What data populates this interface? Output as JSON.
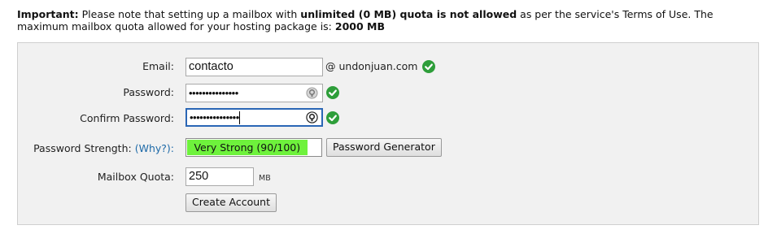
{
  "notice": {
    "important": "Important:",
    "t1": " Please note that setting up a mailbox with ",
    "t2": "unlimited (0 MB) quota is not allowed",
    "t3": " as per the service's Terms of Use. The maximum mailbox quota allowed for your hosting package is: ",
    "t4": "2000 MB"
  },
  "form": {
    "email_label": "Email:",
    "email_value": "contacto",
    "domain": "@ undonjuan.com",
    "password_label": "Password:",
    "password_value": "•••••••••••••••",
    "confirm_label": "Confirm Password:",
    "confirm_value": "•••••••••••••••",
    "strength_label": "Password Strength:",
    "why_link": "(Why?):",
    "strength_text": "Very Strong (90/100)",
    "strength_percent": 90,
    "generator_button": "Password Generator",
    "quota_label": "Mailbox Quota:",
    "quota_value": "250",
    "quota_unit": "MB",
    "create_button": "Create Account"
  },
  "colors": {
    "valid_check": "#2e9e3a",
    "strength_bar": "#6ef23c",
    "focus_border": "#2a66b5",
    "link": "#1e6aa8"
  },
  "icons": {
    "valid": "check-circle-icon",
    "reveal": "eye-toggle-icon"
  }
}
